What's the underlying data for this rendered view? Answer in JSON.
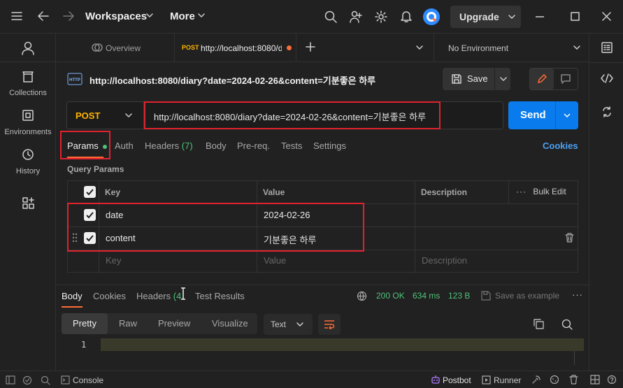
{
  "topbar": {
    "workspaces_label": "Workspaces",
    "more_label": "More",
    "upgrade_label": "Upgrade"
  },
  "leftrail": {
    "items": [
      {
        "label": ""
      },
      {
        "label": "Collections"
      },
      {
        "label": "Environments"
      },
      {
        "label": "History"
      },
      {
        "label": ""
      }
    ]
  },
  "tabs": {
    "overview_label": "Overview",
    "active_method": "POST",
    "active_url": "http://localhost:8080/d",
    "environment_label": "No Environment"
  },
  "request": {
    "name": "http://localhost:8080/diary?date=2024-02-26&content=기분좋은 하루",
    "save_label": "Save",
    "method": "POST",
    "url": "http://localhost:8080/diary?date=2024-02-26&content=기분좋은 하루",
    "send_label": "Send"
  },
  "request_tabs": {
    "params": "Params",
    "auth": "Auth",
    "headers": "Headers",
    "headers_count": "(7)",
    "body": "Body",
    "prereq": "Pre-req.",
    "tests": "Tests",
    "settings": "Settings",
    "cookies": "Cookies"
  },
  "query_params": {
    "title": "Query Params",
    "columns": [
      "Key",
      "Value",
      "Description"
    ],
    "bulk_edit": "Bulk Edit",
    "rows": [
      {
        "key": "date",
        "value": "2024-02-26",
        "description": "",
        "checked": true
      },
      {
        "key": "content",
        "value": "기분좋은 하루",
        "description": "",
        "checked": true
      }
    ],
    "placeholder": {
      "key": "Key",
      "value": "Value",
      "description": "Description"
    }
  },
  "response": {
    "tabs": {
      "body": "Body",
      "cookies": "Cookies",
      "headers": "Headers",
      "headers_count": "(4",
      "test_results": "Test Results"
    },
    "status": "200 OK",
    "time": "634 ms",
    "size": "123 B",
    "save_example": "Save as example",
    "formats": [
      "Pretty",
      "Raw",
      "Preview",
      "Visualize"
    ],
    "text_type": "Text",
    "line_number": "1"
  },
  "statusbar": {
    "console": "Console",
    "postbot": "Postbot",
    "runner": "Runner"
  },
  "colors": {
    "accent_orange": "#ff6c37",
    "send_blue": "#097bed",
    "method_yellow": "#ffb400",
    "status_green": "#4fc27a",
    "highlight_red": "#e0232f"
  }
}
